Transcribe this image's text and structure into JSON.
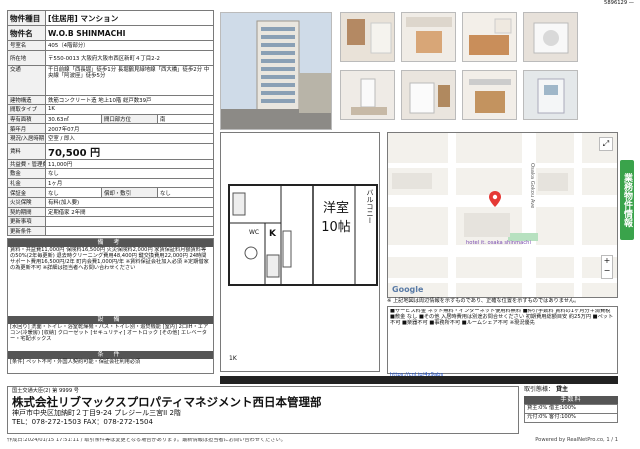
{
  "top_code": "5896129 —",
  "property": {
    "rows": [
      {
        "k": "物件種目",
        "v": "[住居用] マンション"
      },
      {
        "k": "物件名",
        "v": "W.O.B SHINMACHI"
      },
      {
        "k": "号室名",
        "v": "405（4階部分）"
      },
      {
        "k": "所在地",
        "v": "〒550-0013 大阪府大阪市西区新町４丁目2-2"
      },
      {
        "k": "交通",
        "v": "千日前線「西長堀」徒歩1分 長堀鶴見緑地線「西大橋」徒歩2分 中央線「阿波座」徒歩5分"
      },
      {
        "k": "建物構造",
        "v": "鉄筋コンクリート造 地上10階 総戸数39戸"
      },
      {
        "k": "間取タイプ",
        "v": "1K"
      },
      {
        "k": "専有面積",
        "v": "30.63㎡",
        "k2": "間口部方位",
        "v2": "南"
      },
      {
        "k": "築年月",
        "v": "2007年07月"
      },
      {
        "k": "現況/入居時期",
        "v": "空室 / 即入"
      },
      {
        "k": "賃料",
        "v": "70,500 円"
      },
      {
        "k": "共益費・管理費",
        "v": "11,000円"
      },
      {
        "k": "敷金",
        "v": "なし"
      },
      {
        "k": "礼金",
        "v": "1ヶ月"
      },
      {
        "k": "保証金",
        "v": "なし",
        "k2": "償却・敷引",
        "v2": "なし"
      },
      {
        "k": "火災保険",
        "v": "有料(加入要)"
      },
      {
        "k": "契約期間",
        "v": "定期借家 2年間"
      },
      {
        "k": "更新事項",
        "v": ""
      },
      {
        "k": "更新条件",
        "v": ""
      }
    ]
  },
  "notes": {
    "head": "備 考",
    "text": "賃料・共益費11,000円 保険料16,500円 火災保険料2,000円 家賃保証料月額賃料等の50%(2年毎更新) 退去時クリーニング費用48,400円 鍵交換費用22,000円 24時間サポート費用16,500円/2年 町内会費1,000円/年 ※賃料保証会社加入必須 ※定期借家の為更新不可 ※詳細は担当者へお問い合わせください"
  },
  "equipment": {
    "head": "設 備",
    "text": "[水回り] 洗面・トイレ・浴室乾燥機・バス・トイレ別・追焚機能 [室内] 2口IH・エアコン(冷暖房) [収納] クローゼット [セキュリティ] オートロック [その他] エレベーター・宅配ボックス"
  },
  "conditions": {
    "head": "条 件",
    "text": "[条件] ペット不可・外国人契約可能・保証会社利用必須"
  },
  "floorplan": {
    "room_label": "洋室",
    "room_size": "10帖",
    "balcony": "バルコニー",
    "wc_label": "WC",
    "k_label": "K",
    "floor_label": "1K"
  },
  "map": {
    "google": "Google",
    "hotel": "hotel it. osaka shinmachi",
    "street": "Osaka Gokou Ave",
    "note": "※ 上記地図は周辺情報を示すものであり、正確な位置を示すものではありません。"
  },
  "remarks": {
    "text": "■サービス料金 ネット無料・インターネット使用料無料 ■仲介手数料 賃料の1ヶ月分＋消費税 ■敷金 なし ■その他 入居時費用は別途お問合せください 初期費用総額目安 約25万円 ■ペット不可 ■楽器不可 ■事務所不可 ■ルームシェア不可 ※現況優先",
    "link": "https://cnl.jp/4x9abs"
  },
  "side_tab": "業務物件情報",
  "company": {
    "license": "国土交通大臣(2) 第 9999 号",
    "name": "株式会社リブマックスプロパティマネジメント西日本管理部",
    "address": "神戸市中央区加納町２丁目9-24 プレジール三宮II 2階",
    "tel": "TEL：078-272-1503 FAX：078-272-1504"
  },
  "transaction": {
    "label": "取引態様：",
    "value": "貸主",
    "fee_head": "手数料",
    "fee_rows": [
      "貸主:0% 借主:100%",
      "元付:0% 客付:100%"
    ]
  },
  "footer": {
    "left": "作成日:2024/01/15 17:51:11 / 取引条件等は変更となる場合があります。最新情報は担当者にお問い合わせください。",
    "right": "Powered by RealNetPro.co, 1 / 1"
  },
  "colors": {
    "accent": "#3aa34b",
    "header_bg": "#555555",
    "pin": "#e53935"
  }
}
